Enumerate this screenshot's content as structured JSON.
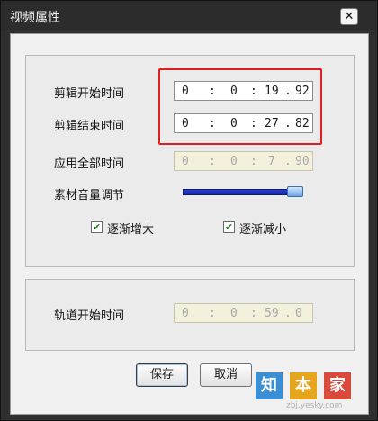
{
  "window": {
    "title": "视频属性",
    "close_glyph": "✕"
  },
  "fields": {
    "clip_start": {
      "label": "剪辑开始时间",
      "h": "0",
      "m": "0",
      "s": "19",
      "f": "92"
    },
    "clip_end": {
      "label": "剪辑结束时间",
      "h": "0",
      "m": "0",
      "s": "27",
      "f": "82"
    },
    "apply_all": {
      "label": "应用全部时间",
      "h": "0",
      "m": "0",
      "s": "7",
      "f": "90"
    },
    "track_start": {
      "label": "轨道开始时间",
      "h": "0",
      "m": "0",
      "s": "59",
      "f": "0"
    }
  },
  "separators": {
    "colon": ":",
    "dot": "."
  },
  "volume": {
    "label": "素材音量调节",
    "level_fraction": 0.9
  },
  "checkboxes": {
    "fade_in": {
      "label": "逐渐增大",
      "checked": true
    },
    "fade_out": {
      "label": "逐渐减小",
      "checked": true
    }
  },
  "buttons": {
    "save": "保存",
    "cancel": "取消"
  },
  "watermark": {
    "chars": [
      "知",
      "本",
      "家"
    ],
    "url": "zbj.yesky.com"
  },
  "colors": {
    "highlight": "#e02020",
    "slider": "#1a2fb8"
  }
}
